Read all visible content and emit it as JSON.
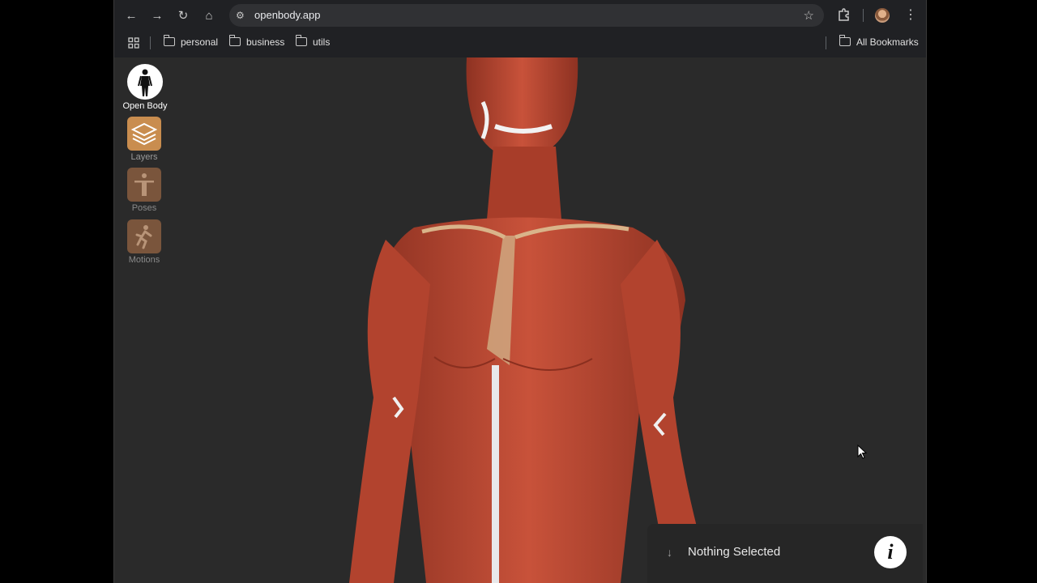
{
  "browser": {
    "url": "openbody.app",
    "bookmarks": [
      {
        "label": "personal"
      },
      {
        "label": "business"
      },
      {
        "label": "utils"
      }
    ],
    "all_bookmarks_label": "All Bookmarks"
  },
  "sidebar": {
    "brand_label": "Open Body",
    "items": [
      {
        "label": "Layers",
        "icon": "layers-icon",
        "state": "active"
      },
      {
        "label": "Poses",
        "icon": "pose-icon",
        "state": "inactive"
      },
      {
        "label": "Motions",
        "icon": "running-figure-icon",
        "state": "inactive"
      }
    ]
  },
  "info_panel": {
    "status": "Nothing Selected",
    "info_icon": "i"
  },
  "colors": {
    "active_tile": "#c98d4f",
    "inactive_tile": "#7a553c",
    "active_label": "#9a9a9a",
    "inactive_label": "#8a8a8a",
    "brand_label": "#ffffff",
    "muscle": "#b9452f",
    "background": "#2a2a2a"
  }
}
